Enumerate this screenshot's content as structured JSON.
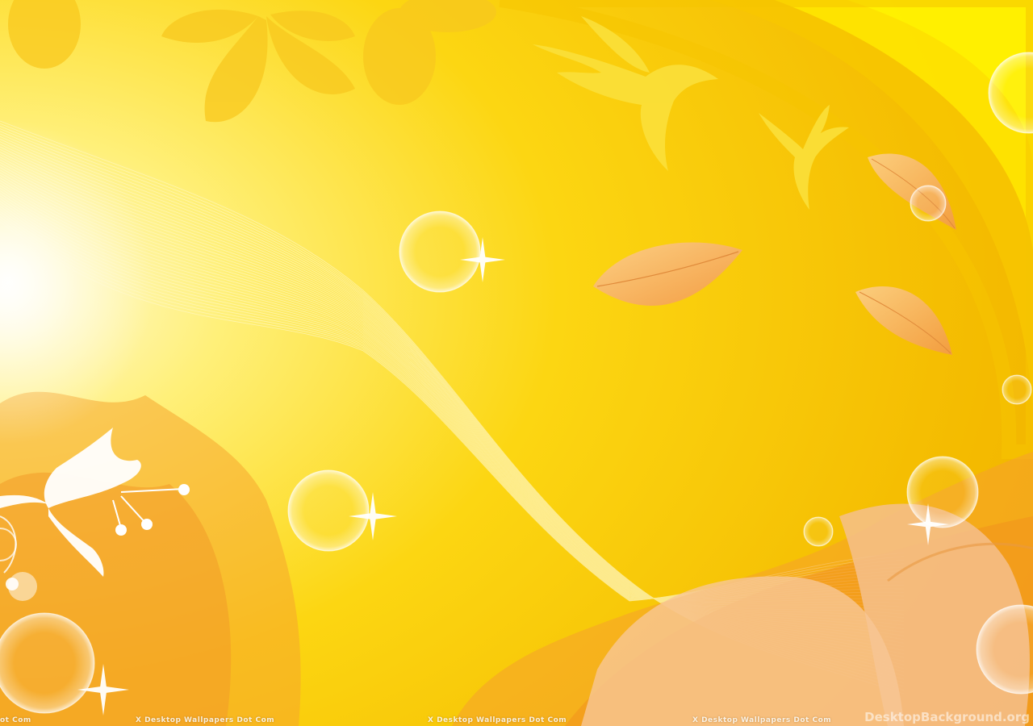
{
  "wallpaper": {
    "palette": {
      "sky_light": "#fff9c8",
      "sky_yellow": "#fbd615",
      "sky_deep": "#f2b400",
      "arc_yellow": "#ffee00",
      "leaf_peach": "#f8b46a",
      "foliage_orange": "#f39a2a",
      "glow_white": "#ffffff"
    },
    "elements": [
      "flowers-top",
      "bird-large",
      "bird-small",
      "falling-leaves",
      "bubbles",
      "sparkles",
      "white-lily",
      "wave-lines",
      "foliage-bottom"
    ]
  },
  "watermarks": {
    "repeated_text": "X Desktop Wallpapers Dot Com",
    "partial_left": "ot Com",
    "site": "DesktopBackground.org"
  }
}
